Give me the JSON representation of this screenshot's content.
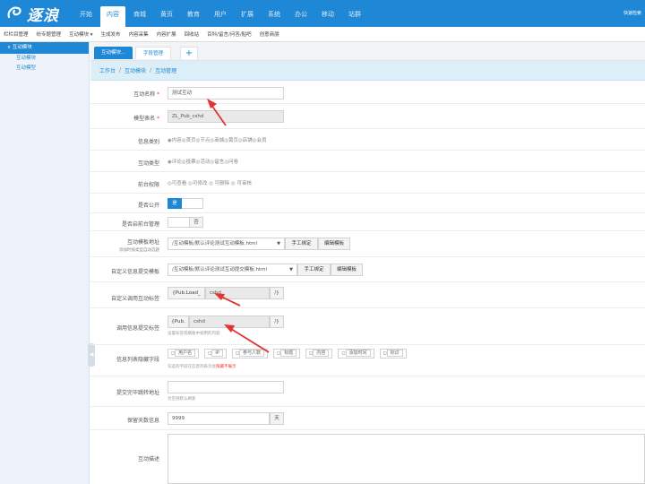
{
  "topbar": {
    "logo_text": "逐浪",
    "nav": [
      "开始",
      "内容",
      "商城",
      "黄页",
      "教育",
      "用户",
      "扩展",
      "系统",
      "办公",
      "移动",
      "站群"
    ],
    "active_nav": "内容",
    "user_link": "快速检索"
  },
  "subbar": {
    "items": [
      "栏栏目管理",
      "纷专题管理",
      "互动模块 ▾",
      "生成发布",
      "内容采集",
      "内容扩展",
      "回收站",
      "百科/留言/问答/贴吧",
      "创意商朋"
    ]
  },
  "sidebar": {
    "header": "∨ 互动模块",
    "items": [
      "互动模块",
      "互动模型"
    ]
  },
  "tabs": {
    "tab1": "互动模块...",
    "tab2": "字段管理",
    "add": "+"
  },
  "breadcrumb": [
    "工作台",
    "互动模块",
    "互动管理"
  ],
  "form": {
    "name_label": "互动名称",
    "name_value": "测试互动",
    "table_label": "模型表名",
    "table_value": "ZL_Pub_cshd",
    "info_type_label": "信息类别",
    "info_type_options": "◉内容◎首页◎节点◎商城◎黄页◎店铺◎会员",
    "interact_type_label": "互动类型",
    "interact_type_options": "◉评论◎投票◎活动◎留言◎问卷",
    "perm_label": "前台权限",
    "perm_options": "◎可查看 ◎可修改 ◎ 可删除 ◎ 可审核",
    "public_label": "是否公开",
    "public_on": "是",
    "mgmt_label": "是否启前台管理",
    "mgmt_off": "否",
    "template_label": "互动模板地址",
    "template_sub": "添加时按类型自动选题",
    "template_value": "/互动模板/默认评论测试互动模板.html",
    "manual_bind": "手工绑定",
    "edit_template": "编辑模板",
    "submit_template_label": "自定义信息提交模板",
    "submit_template_value": "/互动模板/默认评论测试互动提交模板.html",
    "manual_bind2": "手工绑定",
    "edit_template2": "编辑模板",
    "custom_tag_label": "自定义调用互动标签",
    "custom_tag_prefix": "{Pub.Load_",
    "custom_tag_value": "cshd",
    "custom_tag_suffix": "/}",
    "call_tag_label": "调用信息提交标签",
    "call_tag_prefix": "{Pub.",
    "call_tag_value": "cshd",
    "call_tag_suffix": "/}",
    "call_tag_hint": "设置标签或模板中调用的内容",
    "fields_label": "信息列表隐藏字段",
    "fields": [
      "用户名",
      "IP",
      "参与人数",
      "标题",
      "内容",
      "添加时间",
      "标识"
    ],
    "fields_hint_a": "勾选的字段在信息列表页会",
    "fields_hint_b": "隐藏不展示",
    "redirect_label": "提交完毕跳转地址",
    "redirect_hint": "为空则默认刷新",
    "days_label": "保留天数信息",
    "days_value": "9999",
    "days_unit": "天",
    "desc_label": "互动描述"
  },
  "colors": {
    "primary": "#1e88d6",
    "arrow": "#e33333",
    "required": "#e33333"
  }
}
